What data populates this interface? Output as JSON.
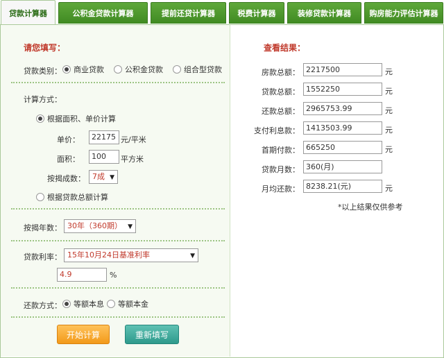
{
  "tabs": [
    "贷款计算器",
    "公积金贷款计算器",
    "提前还贷计算器",
    "税费计算器",
    "装修贷款计算器",
    "购房能力评估计算器"
  ],
  "form": {
    "heading": "请您填写：",
    "loan_type_label": "贷款类别：",
    "loan_types": [
      "商业贷款",
      "公积金贷款",
      "组合型贷款"
    ],
    "calc_method_label": "计算方式：",
    "by_area": "根据面积、单价计算",
    "unit_price_label": "单价：",
    "unit_price": "22175",
    "unit_price_unit": "元/平米",
    "area_label": "面积：",
    "area": "100",
    "area_unit": "平方米",
    "mortgage_ratio_label": "按揭成数：",
    "mortgage_ratio": "7成",
    "by_total": "根据贷款总额计算",
    "years_label": "按揭年数：",
    "years": "30年（360期）",
    "rate_label": "贷款利率：",
    "rate_option": "15年10月24日基准利率",
    "rate_value": "4.9",
    "rate_unit": "%",
    "repay_label": "还款方式：",
    "repay_options": [
      "等额本息",
      "等额本金"
    ],
    "start_button": "开始计算",
    "reset_button": "重新填写"
  },
  "results": {
    "heading": "查看结果：",
    "rows": [
      {
        "label": "房款总额：",
        "value": "2217500",
        "unit": "元"
      },
      {
        "label": "贷款总额：",
        "value": "1552250",
        "unit": "元"
      },
      {
        "label": "还款总额：",
        "value": "2965753.99",
        "unit": "元"
      },
      {
        "label": "支付利息款：",
        "value": "1413503.99",
        "unit": "元"
      },
      {
        "label": "首期付款：",
        "value": "665250",
        "unit": "元"
      },
      {
        "label": "贷款月数：",
        "value": "360(月)",
        "unit": ""
      },
      {
        "label": "月均还款：",
        "value": "8238.21(元)",
        "unit": "元"
      }
    ],
    "note": "*以上结果仅供参考"
  },
  "colors": {
    "tab_green": "#4a9a2a",
    "heading_red": "#c0392b",
    "start_orange": "#f5a623",
    "reset_teal": "#3aa898"
  }
}
